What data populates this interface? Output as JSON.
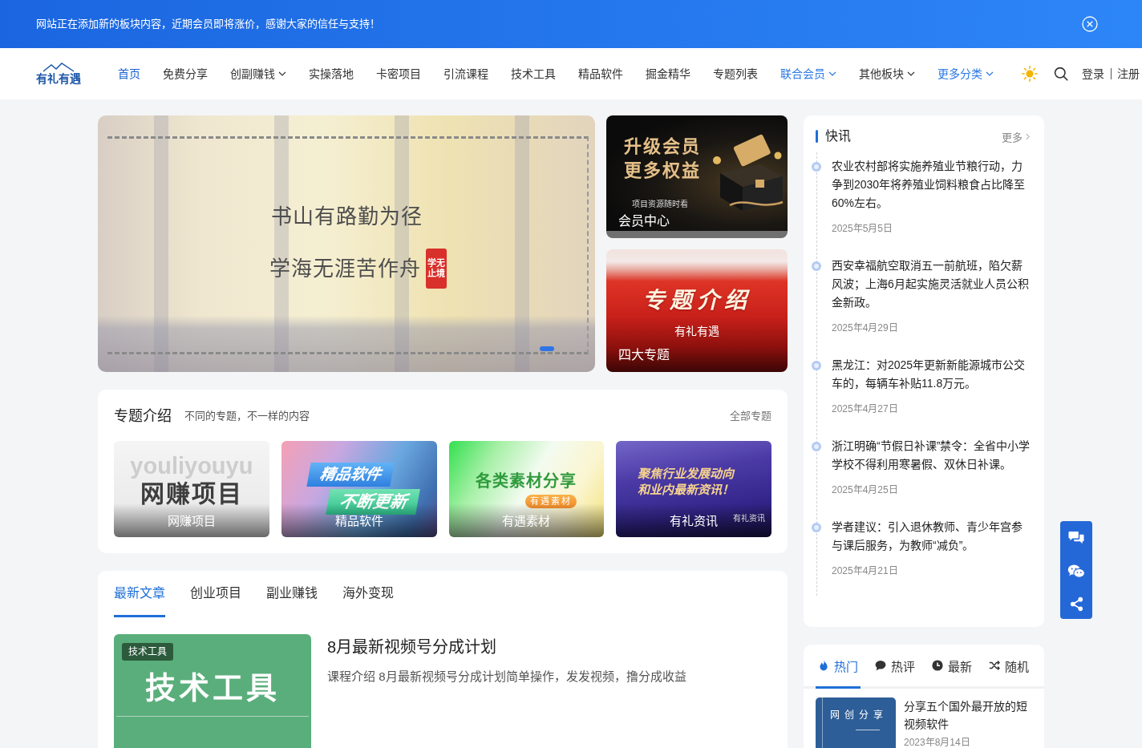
{
  "notice": {
    "text": "网站正在添加新的板块内容，近期会员即将涨价，感谢大家的信任与支持！"
  },
  "nav": {
    "logo": "有礼有遇",
    "items": [
      {
        "label": "首页",
        "selected": true,
        "highlighted": false,
        "dropdown": false
      },
      {
        "label": "免费分享",
        "selected": false,
        "highlighted": false,
        "dropdown": false
      },
      {
        "label": "创副赚钱",
        "selected": false,
        "highlighted": false,
        "dropdown": true
      },
      {
        "label": "实操落地",
        "selected": false,
        "highlighted": false,
        "dropdown": false
      },
      {
        "label": "卡密项目",
        "selected": false,
        "highlighted": false,
        "dropdown": false
      },
      {
        "label": "引流课程",
        "selected": false,
        "highlighted": false,
        "dropdown": false
      },
      {
        "label": "技术工具",
        "selected": false,
        "highlighted": false,
        "dropdown": false
      },
      {
        "label": "精品软件",
        "selected": false,
        "highlighted": false,
        "dropdown": false
      },
      {
        "label": "掘金精华",
        "selected": false,
        "highlighted": false,
        "dropdown": false
      },
      {
        "label": "专题列表",
        "selected": false,
        "highlighted": false,
        "dropdown": false
      },
      {
        "label": "联合会员",
        "selected": false,
        "highlighted": true,
        "dropdown": true
      },
      {
        "label": "其他板块",
        "selected": false,
        "highlighted": false,
        "dropdown": true
      },
      {
        "label": "更多分类",
        "selected": false,
        "highlighted": true,
        "dropdown": true
      }
    ],
    "login": "登录",
    "register": "注册"
  },
  "carousel": {
    "lines": [
      "书山有路勤为径",
      "学海无涯苦作舟"
    ],
    "stamp": "学无止境",
    "dots": [
      {
        "selected": true
      }
    ]
  },
  "promos": [
    {
      "kind": "member",
      "art": [
        "升级会员",
        "更多权益"
      ],
      "note": "项目资源随时看",
      "caption": "会员中心"
    },
    {
      "kind": "topic",
      "art": [
        "专题介绍"
      ],
      "note": "有礼有遇",
      "caption": "四大专题"
    }
  ],
  "topics": {
    "title": "专题介绍",
    "subtitle": "不同的专题，不一样的内容",
    "more": "全部专题",
    "items": [
      {
        "kind": "stack",
        "art": [
          "youliyouyu",
          "网赚项目"
        ],
        "caption": "网赚项目"
      },
      {
        "kind": "ribbons",
        "art": [
          "精品软件",
          "不断更新"
        ],
        "caption": "精品软件"
      },
      {
        "kind": "badge",
        "art": [
          "各类素材分享",
          "有遇素材"
        ],
        "caption": "有遇素材"
      },
      {
        "kind": "headline",
        "art": [
          "聚焦行业发展动向",
          "和业内最新资讯！"
        ],
        "caption": "有礼资讯",
        "corner": "有礼资讯"
      }
    ]
  },
  "articles": {
    "tabs": [
      {
        "label": "最新文章",
        "selected": true
      },
      {
        "label": "创业项目",
        "selected": false
      },
      {
        "label": "副业赚钱",
        "selected": false
      },
      {
        "label": "海外变现",
        "selected": false
      }
    ],
    "items": [
      {
        "category": "技术工具",
        "thumb_text": "技术工具",
        "title": "8月最新视频号分成计划",
        "excerpt": "课程介绍 8月最新视频号分成计划简单操作，发发视频，撸分成收益"
      }
    ]
  },
  "flash": {
    "title": "快讯",
    "more": "更多",
    "items": [
      {
        "text": "农业农村部将实施养殖业节粮行动，力争到2030年将养殖业饲料粮食占比降至60%左右。",
        "date": "2025年5月5日"
      },
      {
        "text": "西安幸福航空取消五一前航班，陷欠薪风波；上海6月起实施灵活就业人员公积金新政。",
        "date": "2025年4月29日"
      },
      {
        "text": "黑龙江：对2025年更新新能源城市公交车的，每辆车补贴11.8万元。",
        "date": "2025年4月27日"
      },
      {
        "text": "浙江明确“节假日补课”禁令：全省中小学学校不得利用寒暑假、双休日补课。",
        "date": "2025年4月25日"
      },
      {
        "text": "学者建议：引入退休教师、青少年宫参与课后服务，为教师“减负”。",
        "date": "2025年4月21日"
      }
    ]
  },
  "hot": {
    "tabs": [
      {
        "label": "热门",
        "selected": true
      },
      {
        "label": "热评",
        "selected": false
      },
      {
        "label": "最新",
        "selected": false
      },
      {
        "label": "随机",
        "selected": false
      }
    ],
    "items": [
      {
        "thumb_text": "网创分享",
        "title": "分享五个国外最开放的短视频软件",
        "date": "2023年8月14日"
      }
    ]
  }
}
